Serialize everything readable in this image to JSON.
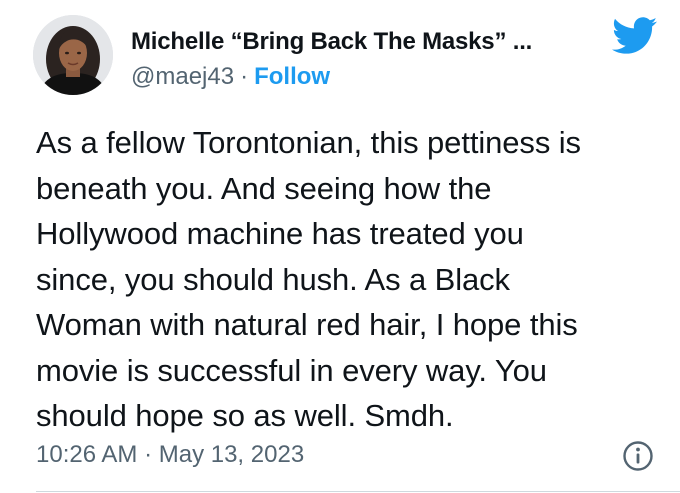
{
  "author": {
    "display_name": "Michelle “Bring Back The Masks” ...",
    "handle": "@maej43",
    "separator": "·",
    "follow_label": "Follow"
  },
  "tweet": {
    "text_lines": [
      "As a fellow Torontonian, this pettiness is",
      "beneath you. And seeing how the",
      "Hollywood machine has treated you",
      "since, you should hush. As a Black",
      "Woman with natural red hair, I hope this",
      "movie is successful in every way. You",
      "should hope so as well. Smdh."
    ],
    "timestamp": "10:26 AM · May 13, 2023"
  },
  "icons": {
    "logo": "twitter-bird-icon",
    "info": "info-icon",
    "avatar": "avatar"
  },
  "colors": {
    "text": "#0f1419",
    "secondary_text": "#536471",
    "accent": "#1d9bf0"
  }
}
